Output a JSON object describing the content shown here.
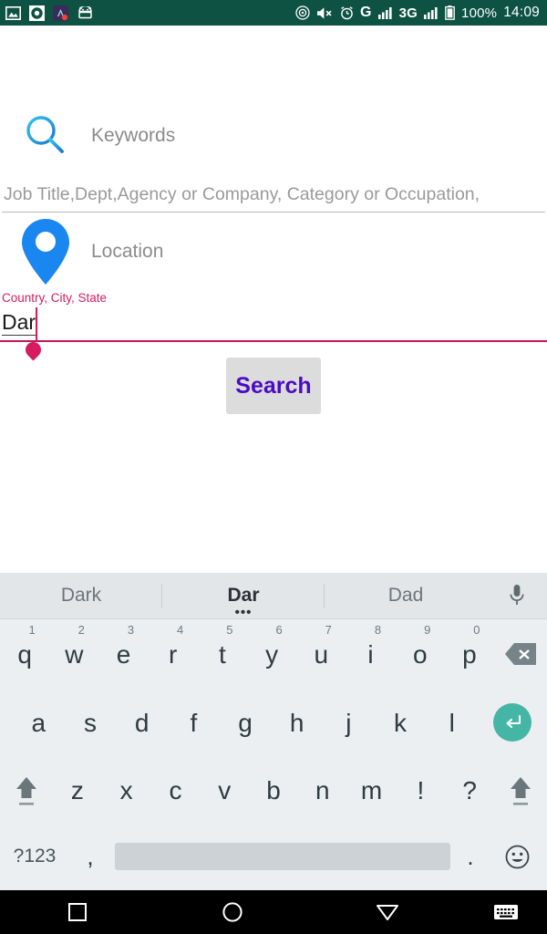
{
  "status_bar": {
    "background": "#0d5243",
    "left_icons": [
      "image-icon",
      "record-icon",
      "app-badge-icon",
      "android-icon"
    ],
    "right_icons": [
      "cast-icon",
      "mute-icon",
      "alarm-icon"
    ],
    "carrier_letter": "G",
    "network_type": "3G",
    "battery_percent": "100%",
    "time": "14:09"
  },
  "form": {
    "keywords": {
      "icon": "search-icon",
      "label": "Keywords",
      "placeholder": "Job Title,Dept,Agency or Company, Category or Occupation,",
      "value": ""
    },
    "location": {
      "icon": "map-pin-icon",
      "label": "Location",
      "float_label": "Country, City, State",
      "value": "Dar",
      "accent_color": "#d81b60"
    },
    "search_button": {
      "label": "Search",
      "text_color": "#4b0bc4",
      "background": "#dcdcdc"
    }
  },
  "keyboard": {
    "suggestions": [
      {
        "text": "Dark",
        "active": false
      },
      {
        "text": "Dar",
        "active": true
      },
      {
        "text": "Dad",
        "active": false
      }
    ],
    "mic_icon": "microphone-icon",
    "row1": [
      {
        "letter": "q",
        "num": "1"
      },
      {
        "letter": "w",
        "num": "2"
      },
      {
        "letter": "e",
        "num": "3"
      },
      {
        "letter": "r",
        "num": "4"
      },
      {
        "letter": "t",
        "num": "5"
      },
      {
        "letter": "y",
        "num": "6"
      },
      {
        "letter": "u",
        "num": "7"
      },
      {
        "letter": "i",
        "num": "8"
      },
      {
        "letter": "o",
        "num": "9"
      },
      {
        "letter": "p",
        "num": "0"
      }
    ],
    "row2": [
      "a",
      "s",
      "d",
      "f",
      "g",
      "h",
      "j",
      "k",
      "l"
    ],
    "row3": [
      "z",
      "x",
      "c",
      "v",
      "b",
      "n",
      "m",
      "!",
      "?"
    ],
    "row4": {
      "symbols_key": "?123",
      "comma_key": ",",
      "period_key": ".",
      "emoji_key": "emoji-icon",
      "space_key": ""
    },
    "enter_icon": "enter-icon",
    "backspace_icon": "backspace-icon",
    "shift_icon": "shift-icon",
    "enter_color": "#45b5a6"
  },
  "navbar": {
    "recent_label": "recent-apps",
    "home_label": "home",
    "back_label": "back",
    "keyboard_label": "switch-keyboard"
  }
}
